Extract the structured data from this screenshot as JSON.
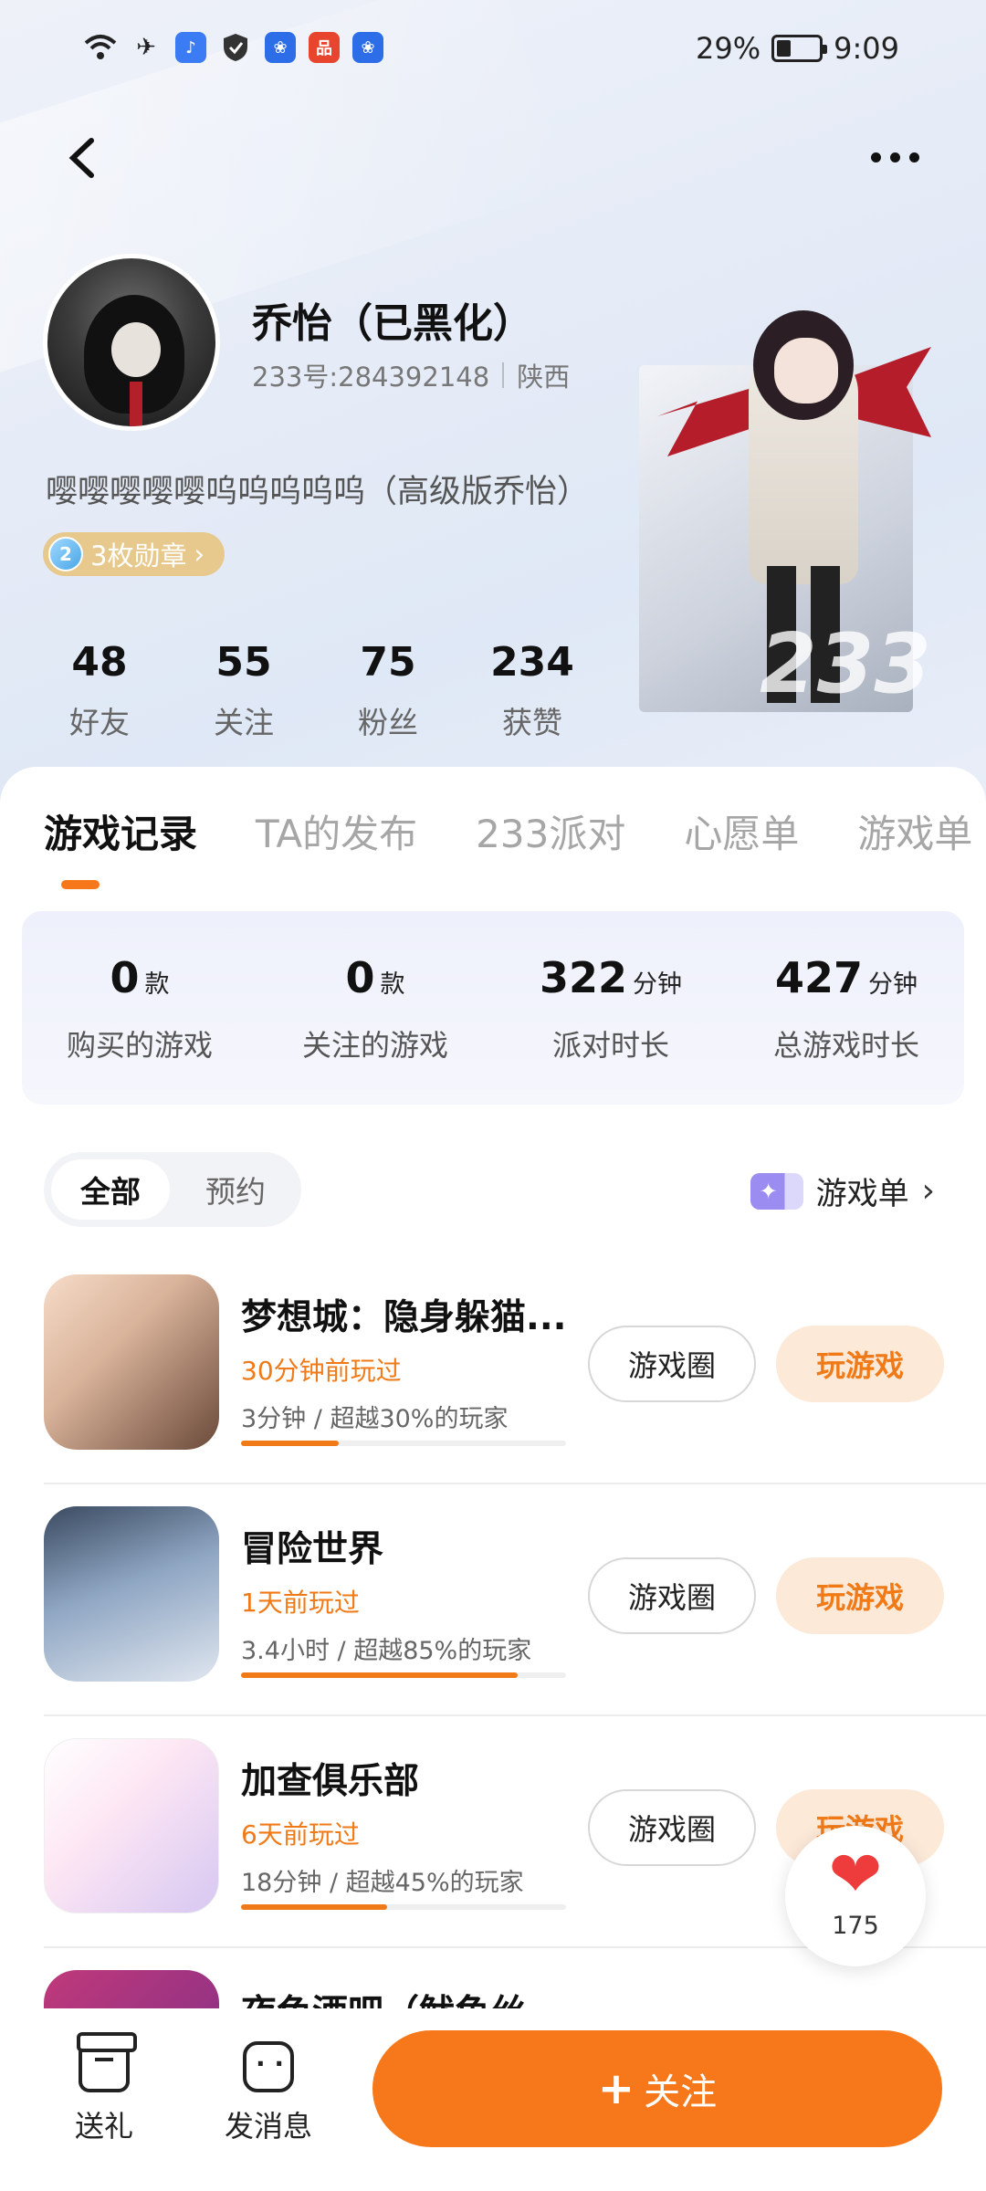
{
  "status_bar": {
    "battery": "29%",
    "battery_level": 0.29,
    "time": "9:09",
    "icons": [
      "wifi-icon",
      "airplane-icon",
      "music-app-icon",
      "shield-icon",
      "baidu-app-icon",
      "shopping-app-icon",
      "baidu-app-icon"
    ]
  },
  "profile": {
    "name": "乔怡（已黑化）",
    "uid": "233号:284392148",
    "region": "陕西",
    "bio": "嘤嘤嘤嘤嘤呜呜呜呜呜（高级版乔怡）",
    "medal_label": "3枚勋章",
    "medal_level": "2",
    "stats": [
      {
        "value": "48",
        "label": "好友"
      },
      {
        "value": "55",
        "label": "关注"
      },
      {
        "value": "75",
        "label": "粉丝"
      },
      {
        "value": "234",
        "label": "获赞"
      }
    ],
    "character_label": "233"
  },
  "tabs": [
    "游戏记录",
    "TA的发布",
    "233派对",
    "心愿单",
    "游戏单"
  ],
  "summary": [
    {
      "value": "0",
      "unit": "款",
      "label": "购买的游戏"
    },
    {
      "value": "0",
      "unit": "款",
      "label": "关注的游戏"
    },
    {
      "value": "322",
      "unit": "分钟",
      "label": "派对时长"
    },
    {
      "value": "427",
      "unit": "分钟",
      "label": "总游戏时长"
    }
  ],
  "filter": {
    "all": "全部",
    "reserve": "预约"
  },
  "game_list_link": "游戏单",
  "games": [
    {
      "title": "梦想城：隐身躲猫...",
      "last_played": "30分钟前玩过",
      "stat": "3分钟 / 超越30%的玩家",
      "percent": 0.3,
      "circle_btn": "游戏圈",
      "play_btn": "玩游戏"
    },
    {
      "title": "冒险世界",
      "last_played": "1天前玩过",
      "stat": "3.4小时 / 超越85%的玩家",
      "percent": 0.85,
      "circle_btn": "游戏圈",
      "play_btn": "玩游戏"
    },
    {
      "title": "加查俱乐部",
      "last_played": "6天前玩过",
      "stat": "18分钟 / 超越45%的玩家",
      "percent": 0.45,
      "circle_btn": "游戏圈",
      "play_btn": "玩游戏"
    },
    {
      "title": "夜色酒吧（鱿鱼丝..."
    }
  ],
  "like": {
    "count": "175"
  },
  "bottom": {
    "gift": "送礼",
    "message": "发消息",
    "follow": "关注"
  },
  "colors": {
    "accent": "#f7781a",
    "play_bg": "#fde9d8",
    "summary_bg": "#eef0fb"
  }
}
